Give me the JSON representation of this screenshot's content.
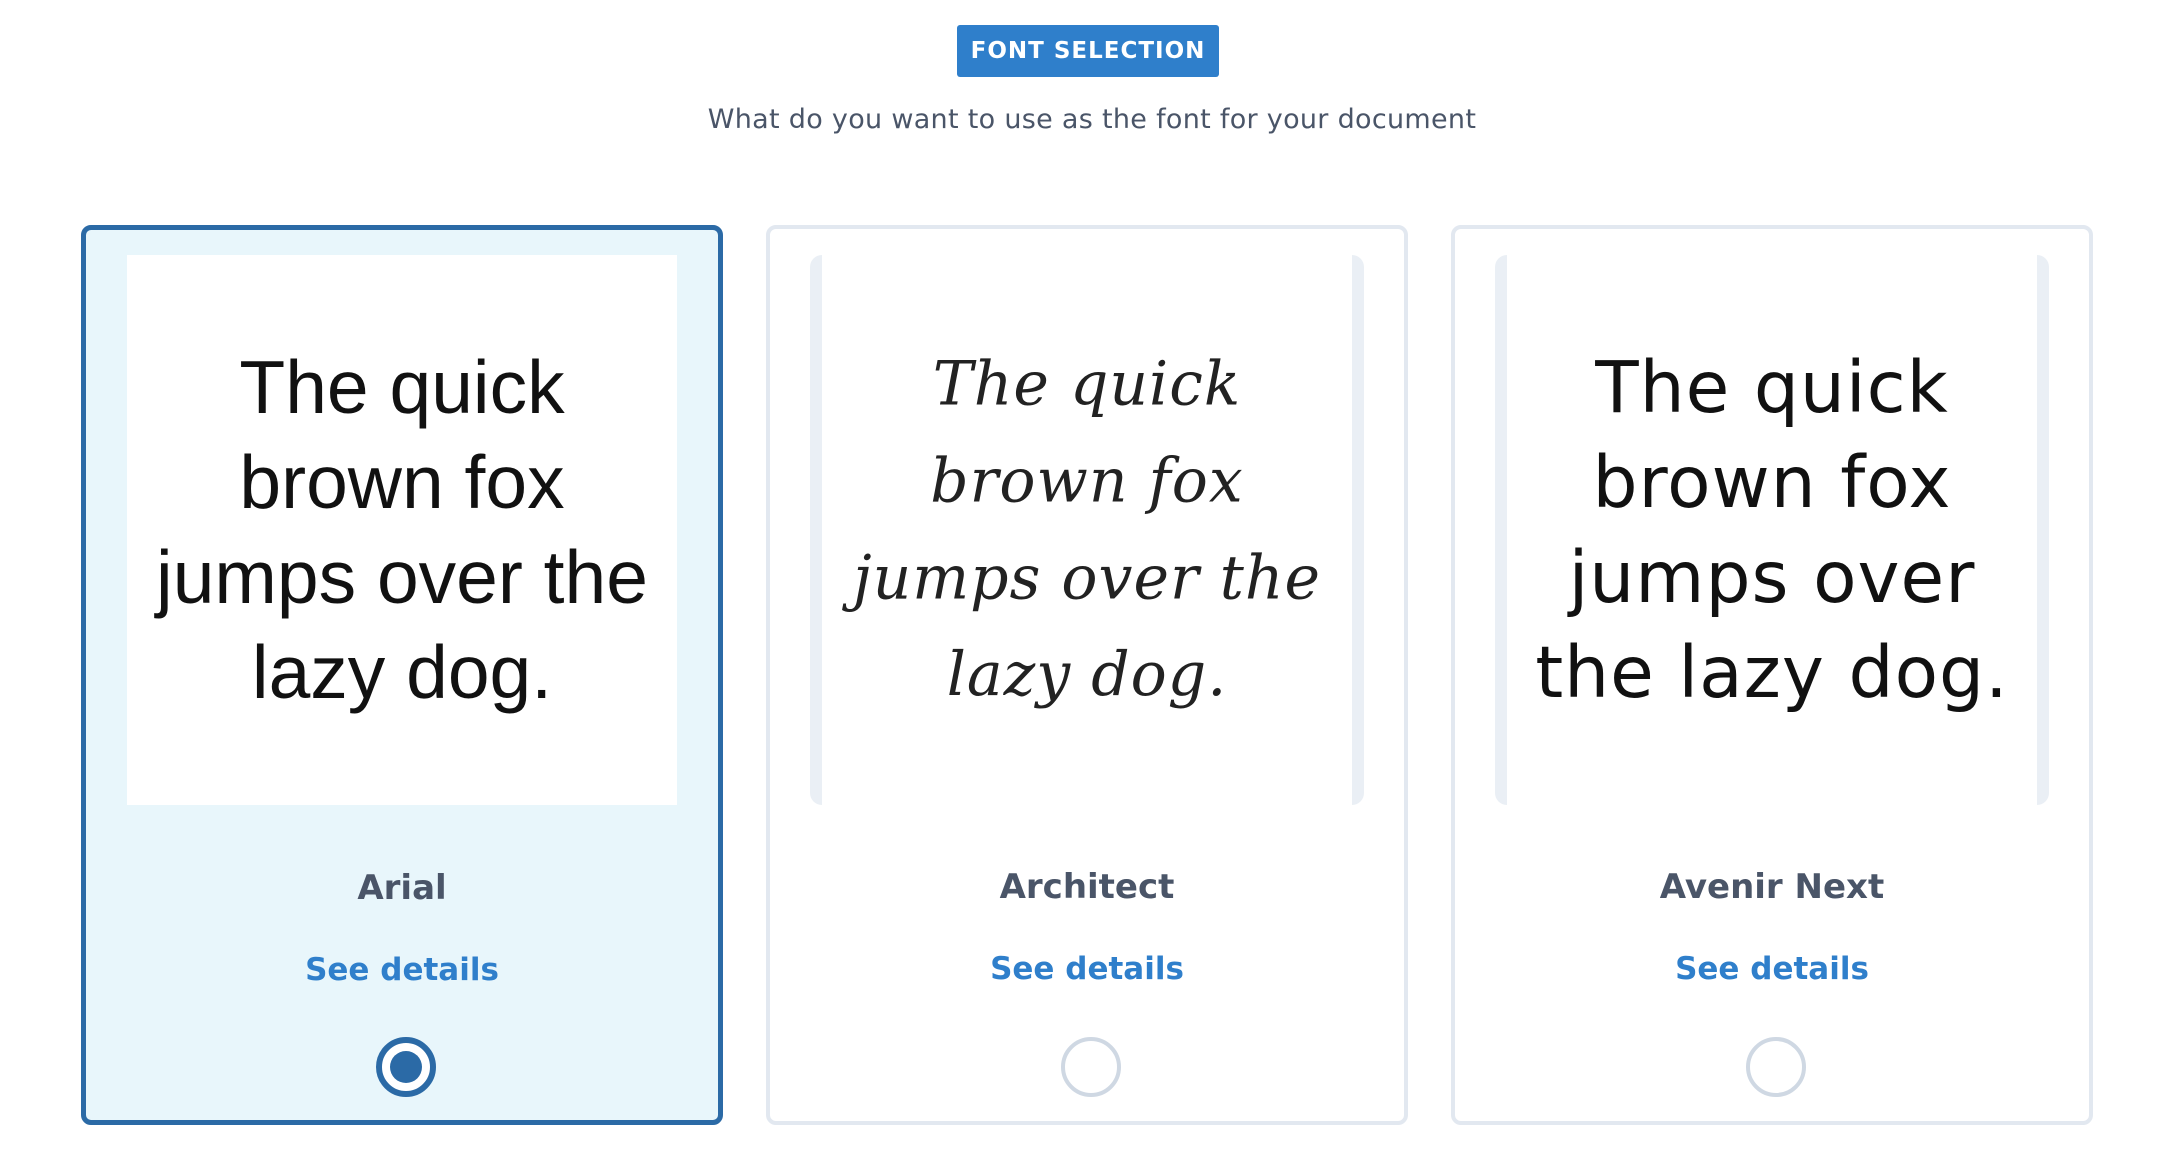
{
  "header": {
    "badge_label": "FONT SELECTION",
    "subtitle": "What do you want to use as the font for your document"
  },
  "fonts": [
    {
      "name": "Arial",
      "sample": "The quick brown fox jumps over the lazy dog.",
      "details_label": "See details",
      "selected": true
    },
    {
      "name": "Architect",
      "sample": "The quick brown fox jumps over the lazy dog.",
      "details_label": "See details",
      "selected": false
    },
    {
      "name": "Avenir Next",
      "sample": "The quick brown fox jumps over the lazy dog.",
      "details_label": "See details",
      "selected": false
    }
  ],
  "colors": {
    "accent": "#2f7fcb",
    "selected_border": "#2b6aa6",
    "selected_background": "#e8f6fb",
    "card_border": "#e2e8f0",
    "text_muted": "#4a5568"
  }
}
